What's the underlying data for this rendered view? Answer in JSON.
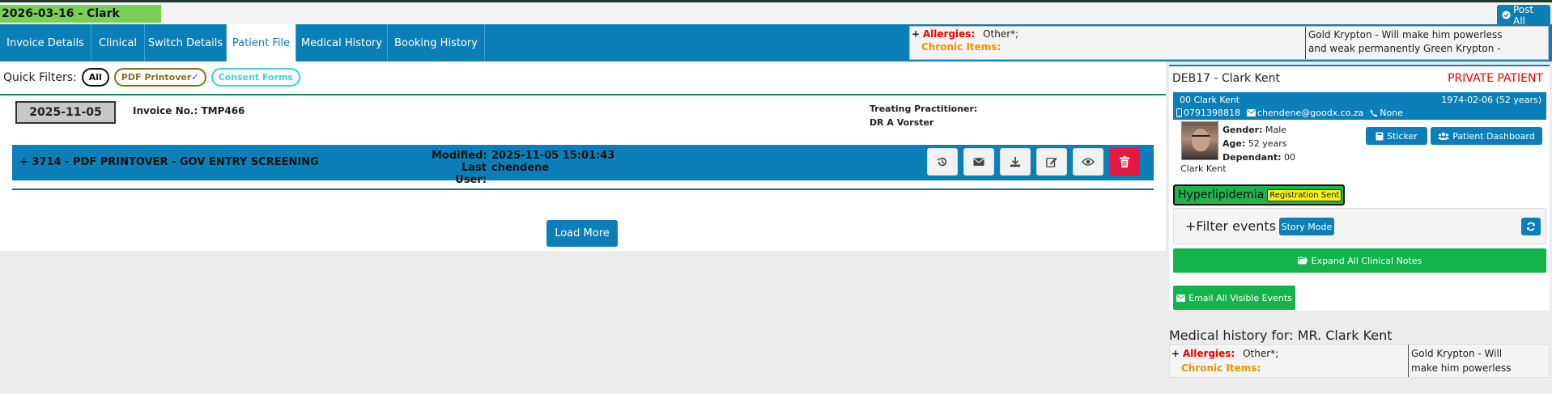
{
  "header": {
    "date_banner": "2026-03-16 - Clark",
    "post_all_label": "Post All"
  },
  "tabs": [
    {
      "label": "Invoice Details"
    },
    {
      "label": "Clinical"
    },
    {
      "label": "Switch Details"
    },
    {
      "label": "Patient File"
    },
    {
      "label": "Medical History"
    },
    {
      "label": "Booking History"
    }
  ],
  "allergy_panel": {
    "plus": "+",
    "allergies_label": "Allergies:",
    "allergies_value": "Other*;",
    "chronic_label": "Chronic Items:",
    "note_line1": "Gold Krypton - Will make him powerless",
    "note_line2": "and weak permanently Green Krypton -"
  },
  "quick_filters": {
    "label": "Quick Filters:",
    "all": "All",
    "pdf": "PDF Printover",
    "pdf_check": "✓",
    "consent": "Consent Forms"
  },
  "invoice": {
    "date": "2025-11-05",
    "invoice_no": "Invoice No.: TMP466",
    "treating_label": "Treating Practitioner:",
    "treating_name": "DR A Vorster"
  },
  "entry": {
    "title": "+ 3714 - PDF PRINTOVER - GOV ENTRY SCREENING",
    "modified_label": "Modified:",
    "modified_value": "2025-11-05 15:01:43",
    "last_user_label": "Last User:",
    "last_user_value": "chendene"
  },
  "load_more_label": "Load More",
  "patient": {
    "title": "DEB17 - Clark Kent",
    "type": "PRIVATE PATIENT",
    "account": "00 Clark Kent",
    "dob": "1974-02-06 (52 years)",
    "phone": "0791398818",
    "email": "chendene@goodx.co.za",
    "other_phone": "None",
    "gender_label": "Gender:",
    "gender": "Male",
    "age_label": "Age:",
    "age": "52 years",
    "dependant_label": "Dependant:",
    "dependant": "00",
    "name": "Clark Kent",
    "sticker_label": "Sticker",
    "dashboard_label": "Patient Dashboard",
    "condition": "Hyperlipidemia",
    "condition_badge": "Registration Sent"
  },
  "filter_events": {
    "label": "+Filter events",
    "story_mode": "Story Mode"
  },
  "expand_label": "Expand All Clinical Notes",
  "email_label": "Email All Visible Events",
  "med_history": {
    "title": "Medical history for: MR. Clark Kent",
    "plus": "+",
    "allergies_label": "Allergies:",
    "allergies_value": "Other*;",
    "chronic_label": "Chronic Items:",
    "note_line1": "Gold Krypton - Will",
    "note_line2": "make him powerless"
  }
}
